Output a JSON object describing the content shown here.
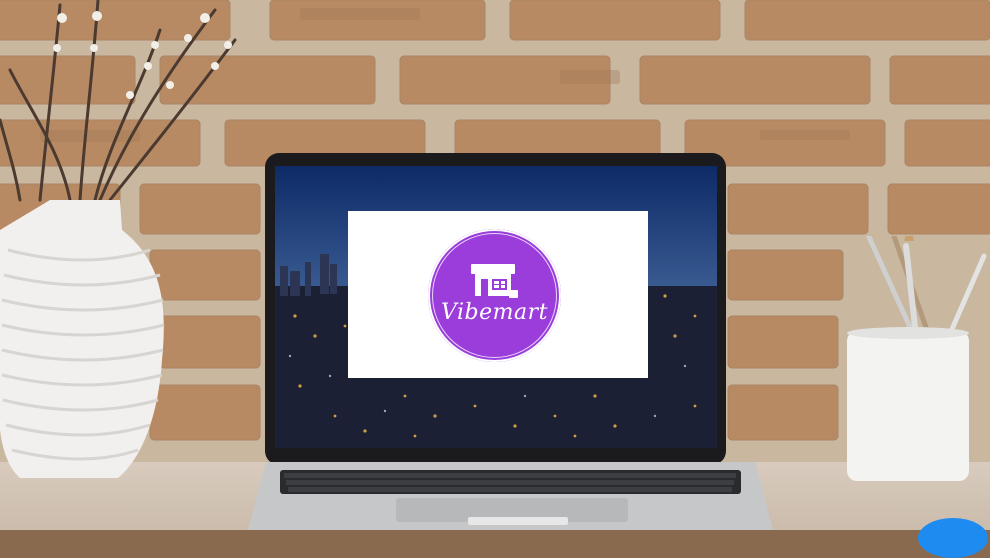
{
  "logo": {
    "brand_name": "Vibemart",
    "icon": "storefront-icon",
    "circle_color": "#9a3ddb"
  },
  "colors": {
    "brick": "#b89472",
    "screen_sky": "#132a58",
    "card": "#ffffff"
  }
}
